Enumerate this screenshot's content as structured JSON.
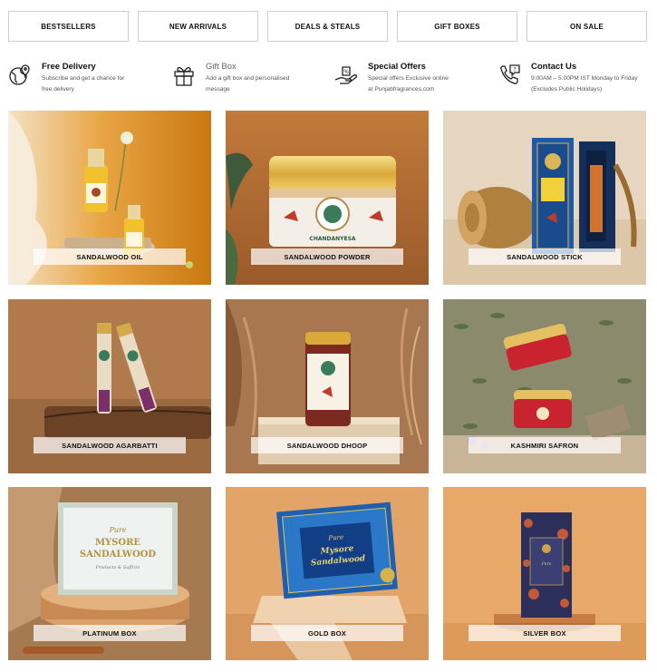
{
  "nav": [
    {
      "label": "BESTSELLERS"
    },
    {
      "label": "NEW ARRIVALS"
    },
    {
      "label": "DEALS & STEALS"
    },
    {
      "label": "GIFT BOXES"
    },
    {
      "label": "ON SALE"
    }
  ],
  "features": [
    {
      "icon": "globe-pin-icon",
      "title": "Free Delivery",
      "desc1": "Subscribe and get a chance for",
      "desc2": "free delivery"
    },
    {
      "icon": "gift-icon",
      "title": "Gift Box",
      "desc1": "Add a gift box and personalised",
      "desc2": "message"
    },
    {
      "icon": "hand-discount-icon",
      "title": "Special Offers",
      "desc1": "Special offers Exclusive online",
      "desc2": "at Punjabfragrances.com"
    },
    {
      "icon": "phone-icon",
      "title": "Contact Us",
      "desc1": "9:00AM – 5:00PM IST Monday to Friday",
      "desc2": "(Excludes Public Holidays)"
    }
  ],
  "products": [
    {
      "label": "SANDALWOOD OIL"
    },
    {
      "label": "SANDALWOOD POWDER"
    },
    {
      "label": "SANDALWOOD STICK"
    },
    {
      "label": "SANDALWOOD AGARBATTI"
    },
    {
      "label": "SANDALWOOD DHOOP"
    },
    {
      "label": "KASHMIRI SAFRON"
    },
    {
      "label": "PLATINUM BOX"
    },
    {
      "label": "GOLD BOX"
    },
    {
      "label": "SILVER BOX"
    }
  ],
  "product_text": {
    "powder_jar": "CHANDANYESA",
    "box_line1": "Pure",
    "box_line2": "MYSORE",
    "box_line3": "SANDALWOOD",
    "box_sub": "Products & Saffron",
    "gold_line2": "Mysore",
    "gold_line3": "Sandalwood"
  },
  "colors": {
    "nav_border": "#cfcfcf",
    "label_bg": "rgba(255,255,255,0.72)",
    "text": "#111111"
  }
}
